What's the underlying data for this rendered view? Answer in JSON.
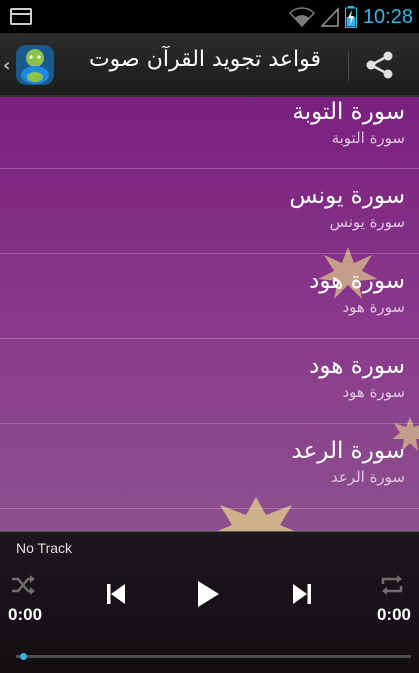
{
  "status_bar": {
    "time": "10:28"
  },
  "action_bar": {
    "title": "قواعد تجويد القرآن صوت",
    "back_icon": "chevron-left-icon",
    "logo_icon": "app-logo-icon",
    "share_icon": "share-icon"
  },
  "list": {
    "items": [
      {
        "title": "سورة التوبة",
        "subtitle": "سورة التوبة"
      },
      {
        "title": "سورة يونس",
        "subtitle": "سورة يونس"
      },
      {
        "title": "سورة هود",
        "subtitle": "سورة هود"
      },
      {
        "title": "سورة هود",
        "subtitle": "سورة هود"
      },
      {
        "title": "سورة الرعد",
        "subtitle": "سورة الرعد"
      }
    ]
  },
  "player": {
    "track": "No Track",
    "elapsed": "0:00",
    "duration": "0:00",
    "progress": 0
  },
  "colors": {
    "accent": "#33b5e5",
    "list_background": "#7a1f7e"
  }
}
